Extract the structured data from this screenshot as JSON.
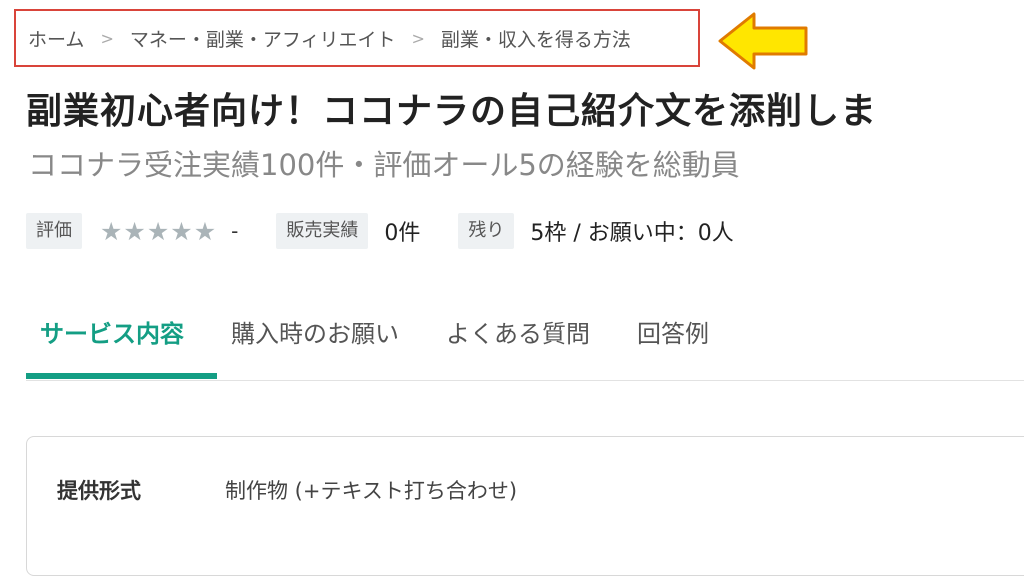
{
  "breadcrumb": {
    "items": [
      "ホーム",
      "マネー・副業・アフィリエイト",
      "副業・収入を得る方法"
    ],
    "separator": ">"
  },
  "annotation": {
    "arrow_color": "#ffe600",
    "box_color": "#d9443a"
  },
  "service": {
    "title": "副業初心者向け！ココナラの自己紹介文を添削しま",
    "subtitle": "ココナラ受注実績100件・評価オール5の経験を総動員"
  },
  "stats": {
    "rating_label": "評価",
    "rating_stars": 5,
    "rating_value": "-",
    "sales_label": "販売実績",
    "sales_value": "0件",
    "remaining_label": "残り",
    "remaining_value": "5枠 / お願い中：0人"
  },
  "tabs": [
    {
      "label": "サービス内容",
      "active": true
    },
    {
      "label": "購入時のお願い",
      "active": false
    },
    {
      "label": "よくある質問",
      "active": false
    },
    {
      "label": "回答例",
      "active": false
    }
  ],
  "accent_color": "#149e84",
  "details": {
    "format_label": "提供形式",
    "format_value": "制作物 (+テキスト打ち合わせ)"
  }
}
